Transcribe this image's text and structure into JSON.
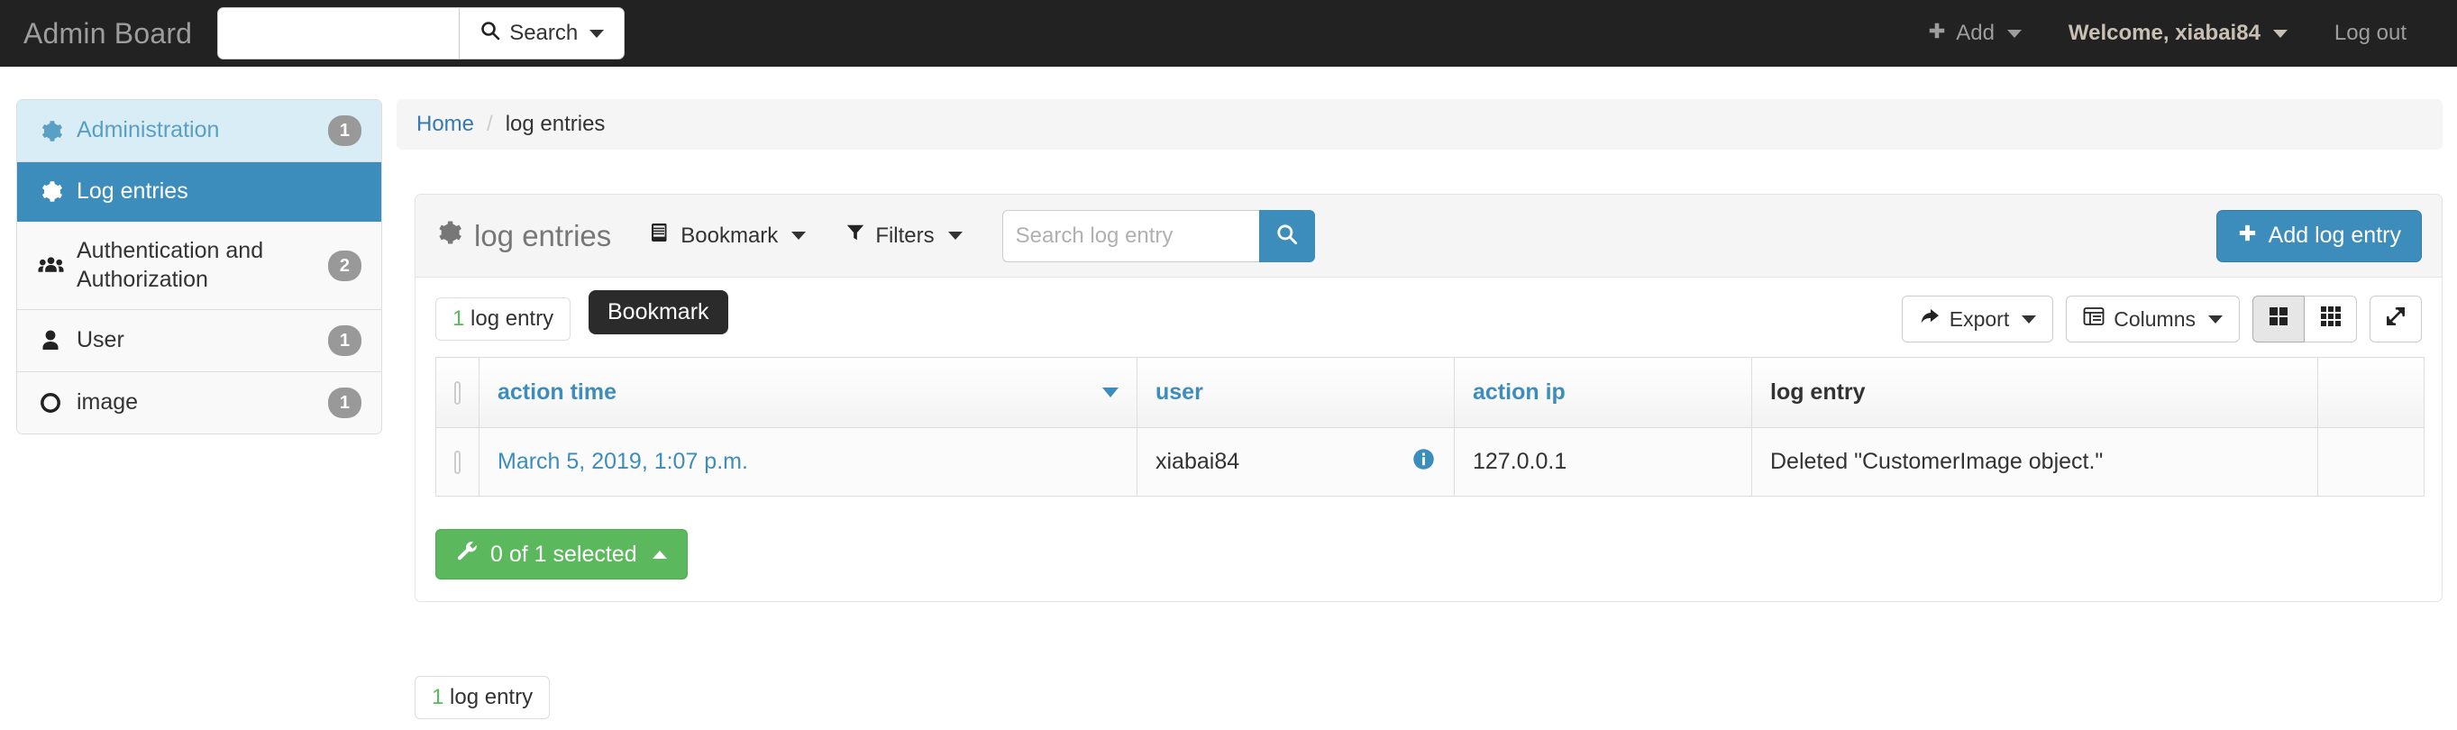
{
  "navbar": {
    "brand": "Admin Board",
    "search_value": "",
    "search_placeholder": "",
    "search_button": "Search",
    "add_label": "Add",
    "welcome_label": "Welcome, xiabai84",
    "logout_label": "Log out"
  },
  "sidebar": {
    "items": [
      {
        "label": "Administration",
        "badge": "1",
        "icon": "gear-icon",
        "state": "head"
      },
      {
        "label": "Log entries",
        "badge": "",
        "icon": "gear-icon",
        "state": "active"
      },
      {
        "label": "Authentication and Authorization",
        "badge": "2",
        "icon": "users-icon",
        "state": "normal"
      },
      {
        "label": "User",
        "badge": "1",
        "icon": "user-icon",
        "state": "normal"
      },
      {
        "label": "image",
        "badge": "1",
        "icon": "circle-icon",
        "state": "normal"
      }
    ]
  },
  "breadcrumb": {
    "home": "Home",
    "separator": "/",
    "current": "log entries"
  },
  "panel": {
    "title": "log entries",
    "bookmark_label": "Bookmark",
    "filters_label": "Filters",
    "search_value": "",
    "search_placeholder": "Search log entry",
    "add_button": "Add log entry"
  },
  "subbar": {
    "count_number": "1",
    "count_text": "log entry",
    "tooltip": "Bookmark",
    "export_label": "Export",
    "columns_label": "Columns"
  },
  "table": {
    "columns": [
      {
        "label": "action time",
        "link": true,
        "sorted": "desc"
      },
      {
        "label": "user",
        "link": true,
        "sorted": ""
      },
      {
        "label": "action ip",
        "link": true,
        "sorted": ""
      },
      {
        "label": "log entry",
        "link": false,
        "sorted": ""
      }
    ],
    "rows": [
      {
        "action_time": "March 5, 2019, 1:07 p.m.",
        "user": "xiabai84",
        "action_ip": "127.0.0.1",
        "log_entry": "Deleted \"CustomerImage object.\""
      }
    ]
  },
  "selection": {
    "label": "0 of 1 selected"
  },
  "footer": {
    "count_number": "1",
    "count_text": "log entry"
  },
  "colors": {
    "navbar_bg": "#222222",
    "primary": "#3c8dbc",
    "success": "#5cb85c",
    "link": "#337ab7",
    "head_bg": "#d9edf7"
  }
}
